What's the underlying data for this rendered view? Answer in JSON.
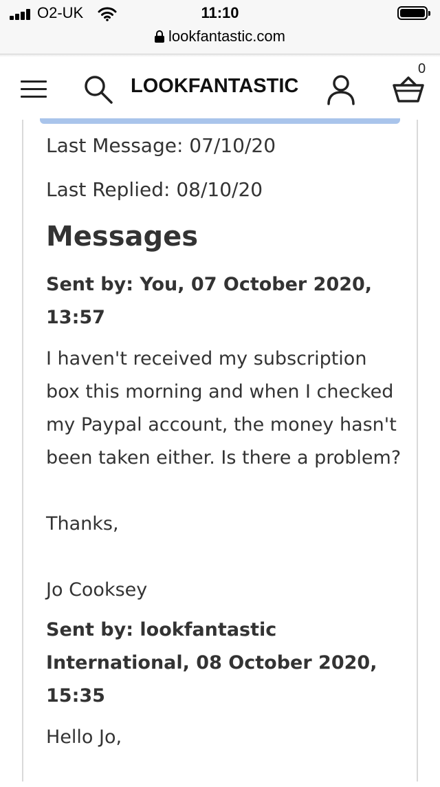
{
  "status_bar": {
    "carrier": "O2-UK",
    "time": "11:10",
    "url": "lookfantastic.com"
  },
  "header": {
    "logo": "LOOKFANTASTIC",
    "basket_count": "0"
  },
  "ticket": {
    "last_message": "Last Message: 07/10/20",
    "last_replied": "Last Replied: 08/10/20"
  },
  "messages": {
    "title": "Messages",
    "items": [
      {
        "sent_by": "Sent by: You, 07 October 2020, 13:57",
        "paragraphs": [
          "I haven't received my subscription box this morning and when I checked my Paypal account, the money hasn't been taken either. Is there a problem?",
          "Thanks,",
          "Jo Cooksey"
        ]
      },
      {
        "sent_by": "Sent by: lookfantastic International, 08 October 2020, 15:35",
        "paragraphs": [
          "Hello Jo,"
        ]
      }
    ]
  },
  "colors": {
    "accent_bar": "#a9c4eb",
    "text": "#333333"
  }
}
